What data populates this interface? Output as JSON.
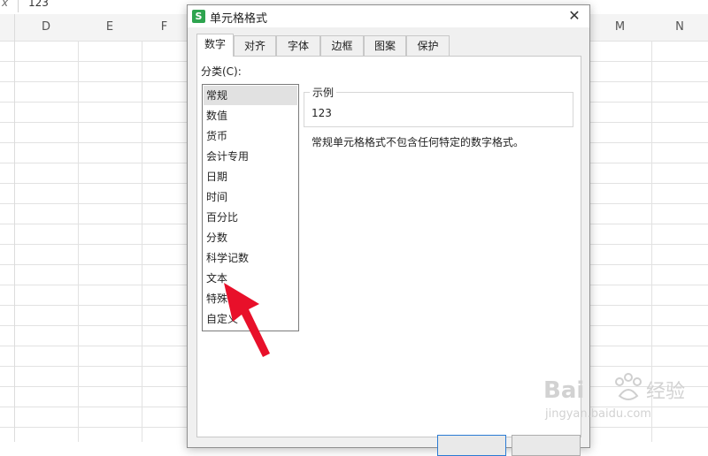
{
  "formula_bar": {
    "fx_label": "x",
    "value": "123"
  },
  "column_headers": [
    "D",
    "E",
    "F",
    "M",
    "N"
  ],
  "dialog": {
    "title": "单元格格式",
    "app_icon_letter": "S",
    "close_symbol": "✕",
    "tabs": [
      {
        "label": "数字",
        "active": true
      },
      {
        "label": "对齐"
      },
      {
        "label": "字体"
      },
      {
        "label": "边框"
      },
      {
        "label": "图案"
      },
      {
        "label": "保护"
      }
    ],
    "category_label": "分类(C):",
    "categories": [
      {
        "label": "常规",
        "selected": true
      },
      {
        "label": "数值"
      },
      {
        "label": "货币"
      },
      {
        "label": "会计专用"
      },
      {
        "label": "日期"
      },
      {
        "label": "时间"
      },
      {
        "label": "百分比"
      },
      {
        "label": "分数"
      },
      {
        "label": "科学记数"
      },
      {
        "label": "文本"
      },
      {
        "label": "特殊"
      },
      {
        "label": "自定义"
      }
    ],
    "sample": {
      "label": "示例",
      "value": "123"
    },
    "description": "常规单元格格式不包含任何特定的数字格式。"
  },
  "annotation": {
    "arrow_color": "#e8102a"
  },
  "watermark": {
    "brand": "Baidu经验",
    "url": "jingyan.baidu.com"
  },
  "colors": {
    "title_bar": "#ffffff",
    "dialog_bg": "#f0f0f0",
    "app_icon": "#2ea44f",
    "primary_button_border": "#2b7bd4"
  }
}
